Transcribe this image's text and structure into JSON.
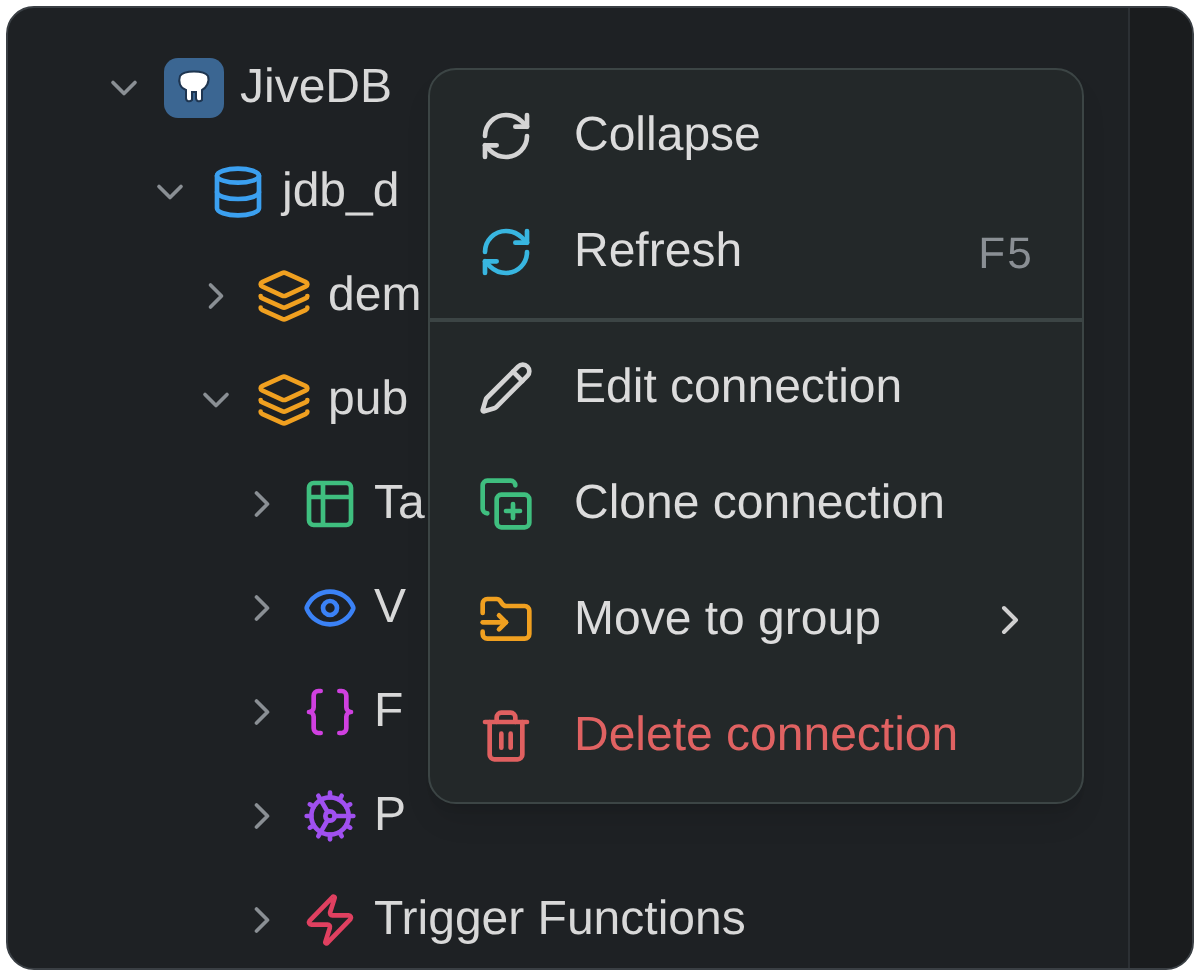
{
  "tree": [
    {
      "label": "JiveDB",
      "kind": "connection",
      "expanded": true,
      "children": [
        {
          "label": "jdb_d",
          "kind": "database",
          "expanded": true,
          "children": [
            {
              "label": "dem",
              "kind": "schema",
              "expanded": false
            },
            {
              "label": "pub",
              "kind": "schema",
              "expanded": true,
              "children": [
                {
                  "label": "Ta",
                  "kind": "tables",
                  "expanded": false
                },
                {
                  "label": "V",
                  "kind": "views",
                  "expanded": false
                },
                {
                  "label": "F",
                  "kind": "functions",
                  "expanded": false
                },
                {
                  "label": "P",
                  "kind": "procedures",
                  "expanded": false
                },
                {
                  "label": "Trigger Functions",
                  "kind": "triggers",
                  "expanded": false
                }
              ]
            }
          ]
        }
      ]
    }
  ],
  "context_menu": {
    "sections": [
      [
        {
          "label": "Collapse",
          "kind": "collapse",
          "color": "#d4d4d4",
          "danger": false
        },
        {
          "label": "Refresh",
          "kind": "refresh",
          "color": "#38b6e0",
          "shortcut": "F5",
          "danger": false
        }
      ],
      [
        {
          "label": "Edit connection",
          "kind": "edit",
          "color": "#d4d4d4",
          "danger": false
        },
        {
          "label": "Clone connection",
          "kind": "clone",
          "color": "#3fbf7f",
          "danger": false
        },
        {
          "label": "Move to group",
          "kind": "move",
          "color": "#f0a020",
          "submenu": true,
          "danger": false
        },
        {
          "label": "Delete connection",
          "kind": "delete",
          "color": "#e06060",
          "danger": true
        }
      ]
    ]
  }
}
